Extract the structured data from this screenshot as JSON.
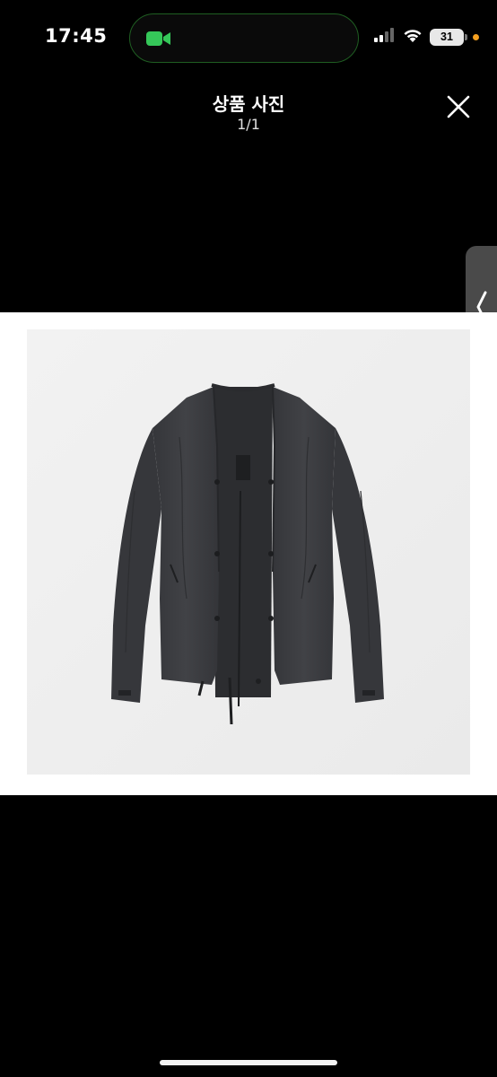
{
  "status_bar": {
    "time": "17:45",
    "battery_level": "31",
    "icons": [
      "facetime-camera-icon",
      "signal-icon",
      "wifi-icon",
      "battery-icon",
      "orange-dot"
    ],
    "call_indicator_color": "#35c759"
  },
  "header": {
    "title": "상품 사진",
    "counter": "1/1",
    "close_icon": "close-icon"
  },
  "viewer": {
    "photo_subject": "photo"
  },
  "side_tab": {
    "icon": "chevron-left-icon"
  },
  "colors": {
    "background": "#000000",
    "photo_background": "#efefef",
    "jacket": "#3b3c3e"
  }
}
